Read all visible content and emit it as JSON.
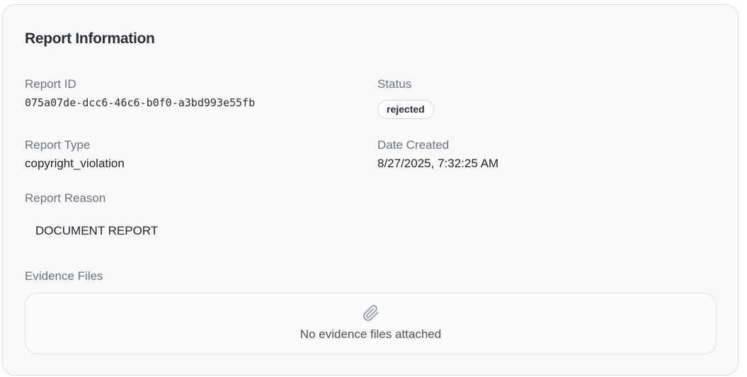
{
  "card": {
    "title": "Report Information"
  },
  "fields": {
    "report_id": {
      "label": "Report ID",
      "value": "075a07de-dcc6-46c6-b0f0-a3bd993e55fb"
    },
    "status": {
      "label": "Status",
      "value": "rejected"
    },
    "report_type": {
      "label": "Report Type",
      "value": "copyright_violation"
    },
    "date_created": {
      "label": "Date Created",
      "value": "8/27/2025, 7:32:25 AM"
    },
    "report_reason": {
      "label": "Report Reason",
      "value": "DOCUMENT REPORT"
    }
  },
  "evidence": {
    "label": "Evidence Files",
    "icon": "paperclip-icon",
    "empty_text": "No evidence files attached"
  },
  "colors": {
    "card_background": "#f9f9fa",
    "label": "#6b7280",
    "badge_border": "#d6d8dc"
  }
}
